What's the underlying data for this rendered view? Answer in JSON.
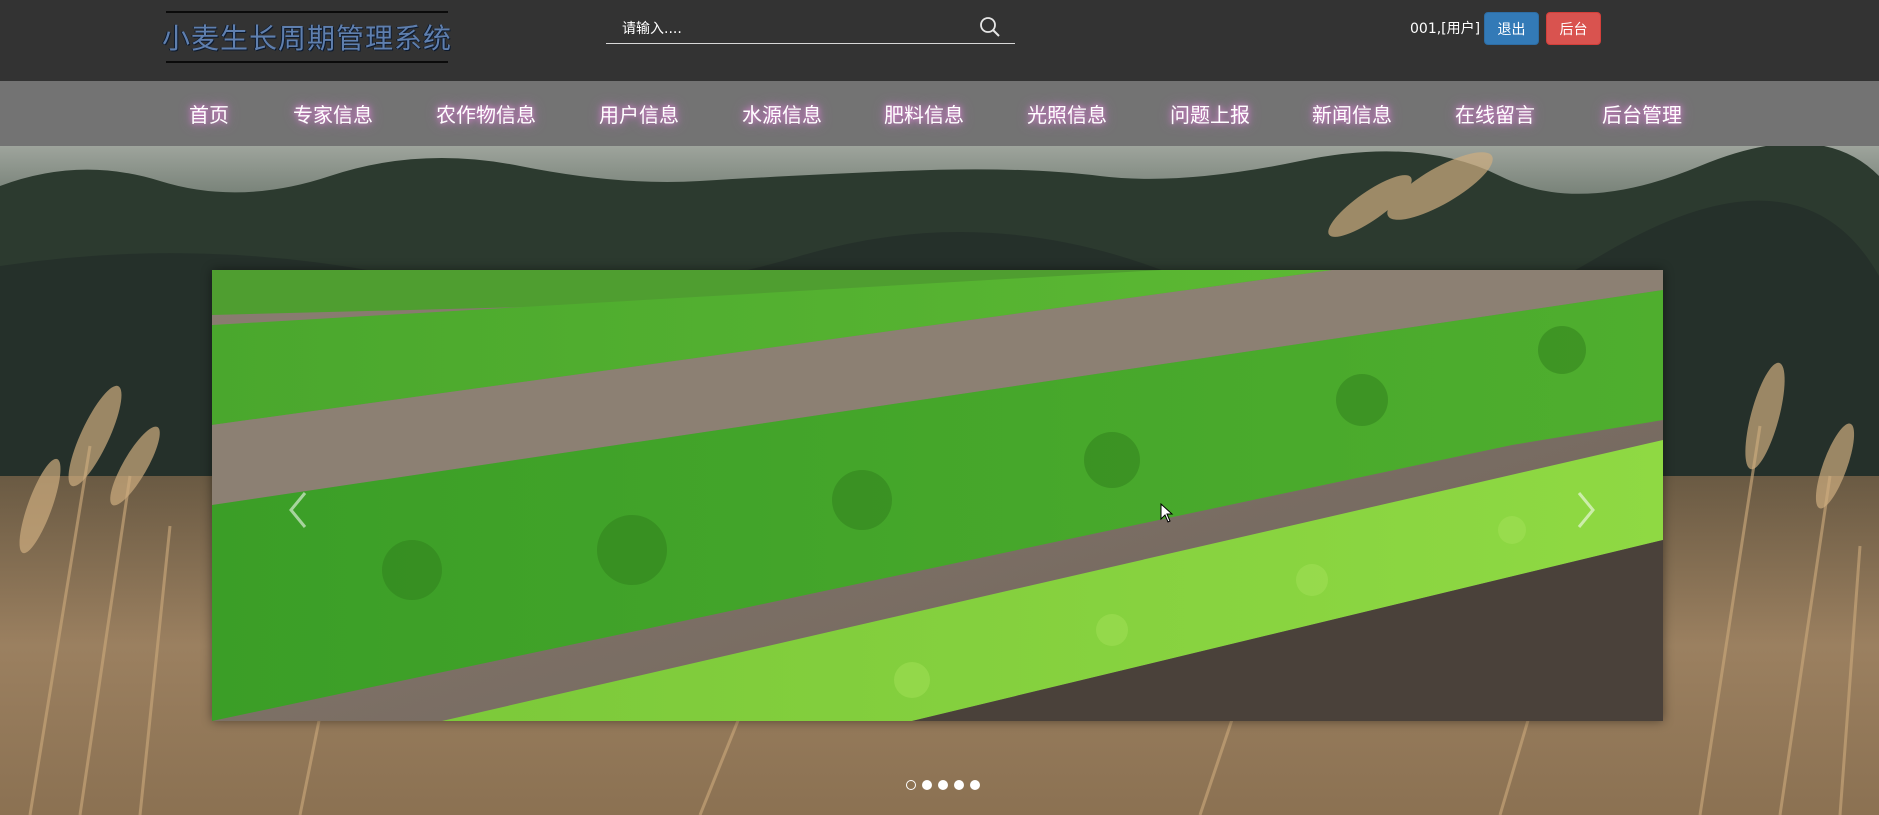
{
  "header": {
    "logo_text": "小麦生长周期管理系统",
    "search_placeholder": "请输入....",
    "user_label": "001,[用户]",
    "logout_label": "退出",
    "admin_label": "后台"
  },
  "nav": {
    "items": [
      {
        "label": "首页"
      },
      {
        "label": "专家信息"
      },
      {
        "label": "农作物信息"
      },
      {
        "label": "用户信息"
      },
      {
        "label": "水源信息"
      },
      {
        "label": "肥料信息"
      },
      {
        "label": "光照信息"
      },
      {
        "label": "问题上报"
      },
      {
        "label": "新闻信息"
      },
      {
        "label": "在线留言"
      },
      {
        "label": "后台管理"
      }
    ]
  },
  "carousel": {
    "slide_count": 5,
    "active_index": 0
  },
  "icons": {
    "search": "search-icon",
    "prev": "chevron-left-icon",
    "next": "chevron-right-icon"
  },
  "colors": {
    "topbar": "#333333",
    "navbar": "#787878",
    "logout_button": "#337ab7",
    "admin_button": "#d9534f",
    "logo_text": "#5f7fae"
  }
}
